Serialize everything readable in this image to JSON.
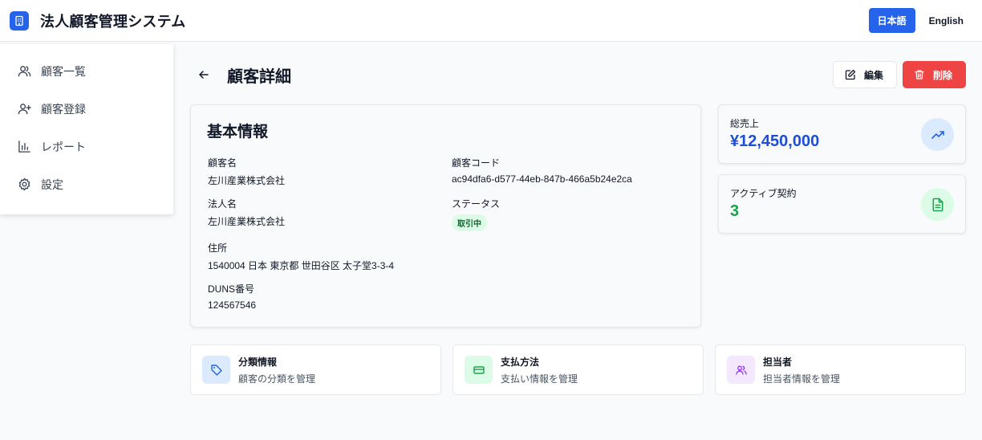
{
  "app": {
    "title": "法人顧客管理システム"
  },
  "language": {
    "japanese": "日本語",
    "english": "English"
  },
  "sidebar": {
    "items": [
      {
        "label": "顧客一覧",
        "icon": "users-icon"
      },
      {
        "label": "顧客登録",
        "icon": "user-plus-icon"
      },
      {
        "label": "レポート",
        "icon": "bar-chart-icon"
      },
      {
        "label": "設定",
        "icon": "gear-icon"
      }
    ]
  },
  "page": {
    "title": "顧客詳細",
    "edit_label": "編集",
    "delete_label": "削除"
  },
  "basic_info": {
    "title": "基本情報",
    "customer_name_label": "顧客名",
    "customer_name": "左川産業株式会社",
    "customer_code_label": "顧客コード",
    "customer_code": "ac94dfa6-d577-44eb-847b-466a5b24e2ca",
    "corporate_name_label": "法人名",
    "corporate_name": "左川産業株式会社",
    "status_label": "ステータス",
    "status": "取引中",
    "address_label": "住所",
    "address": "1540004 日本 東京都 世田谷区 太子堂3-3-4",
    "duns_label": "DUNS番号",
    "duns": "124567546"
  },
  "stats": {
    "total_sales_label": "総売上",
    "total_sales": "¥12,450,000",
    "active_contracts_label": "アクティブ契約",
    "active_contracts": "3"
  },
  "links": [
    {
      "title": "分類情報",
      "subtitle": "顧客の分類を管理",
      "icon": "tag-icon"
    },
    {
      "title": "支払方法",
      "subtitle": "支払い情報を管理",
      "icon": "credit-card-icon"
    },
    {
      "title": "担当者",
      "subtitle": "担当者情報を管理",
      "icon": "people-icon"
    }
  ],
  "colors": {
    "primary": "#2563eb",
    "danger": "#ef4444",
    "success": "#16a34a",
    "status_badge_bg": "#dcfce7"
  }
}
